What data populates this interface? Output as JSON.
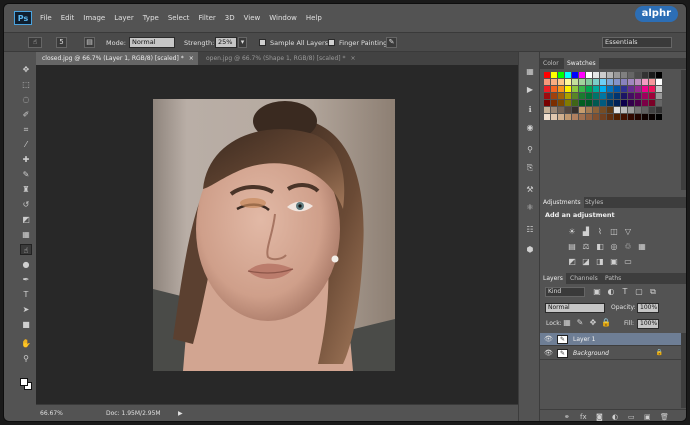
{
  "app": {
    "logo_text": "Ps",
    "watermark": "alphr"
  },
  "menu": [
    "File",
    "Edit",
    "Image",
    "Layer",
    "Type",
    "Select",
    "Filter",
    "3D",
    "View",
    "Window",
    "Help"
  ],
  "options_bar": {
    "brush_size": "5",
    "mode_label": "Mode:",
    "mode_value": "Normal",
    "strength_label": "Strength:",
    "strength_value": "25%",
    "sample_all_layers": "Sample All Layers",
    "finger_painting": "Finger Painting",
    "workspace": "Essentials"
  },
  "tabs": [
    {
      "label": "closed.jpg @ 66.7% (Layer 1, RGB/8) [scaled] *",
      "close": "×",
      "active": true
    },
    {
      "label": "open.jpg @ 66.7% (Shape 1, RGB/8) [scaled] *",
      "close": "×",
      "active": false
    }
  ],
  "status": {
    "zoom": "66.67%",
    "doc": "Doc: 1.95M/2.95M",
    "arrow": "▶"
  },
  "color_panel": {
    "tabs": [
      "Color",
      "Swatches"
    ],
    "active": "Swatches"
  },
  "adjustments_panel": {
    "tabs": [
      "Adjustments",
      "Styles"
    ],
    "title": "Add an adjustment"
  },
  "layers_panel": {
    "tabs": [
      "Layers",
      "Channels",
      "Paths"
    ],
    "kind": "Kind",
    "blend_mode": "Normal",
    "opacity_label": "Opacity:",
    "opacity_value": "100%",
    "lock_label": "Lock:",
    "fill_label": "Fill:",
    "fill_value": "100%",
    "layers": [
      {
        "name": "Layer 1",
        "selected": true
      },
      {
        "name": "Background",
        "selected": false,
        "locked": true
      }
    ]
  },
  "icons": {
    "tools": [
      "move-icon",
      "marquee-icon",
      "lasso-icon",
      "quick-select-icon",
      "crop-icon",
      "eyedropper-icon",
      "spot-heal-icon",
      "brush-icon",
      "clone-stamp-icon",
      "history-brush-icon",
      "eraser-icon",
      "gradient-icon",
      "smudge-icon",
      "dodge-icon",
      "pen-icon",
      "type-icon",
      "path-select-icon",
      "shape-icon",
      "hand-icon",
      "zoom-icon"
    ]
  }
}
